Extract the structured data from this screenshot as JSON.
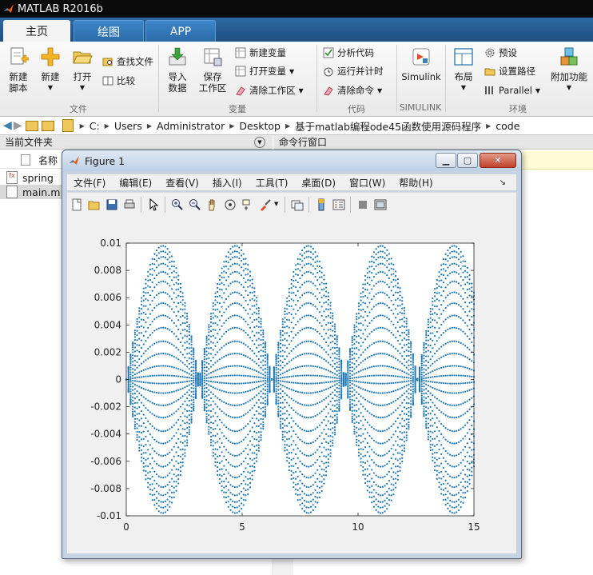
{
  "app": {
    "title": "MATLAB R2016b"
  },
  "tabs": [
    {
      "label": "主页",
      "active": true
    },
    {
      "label": "绘图",
      "active": false
    },
    {
      "label": "APP",
      "active": false
    }
  ],
  "ribbon": {
    "file_group": {
      "label": "文件",
      "new_script": [
        "新建",
        "脚本"
      ],
      "new": "新建",
      "open": "打开",
      "find_files": "查找文件",
      "compare": "比较"
    },
    "variable_group": {
      "label": "变量",
      "import_data": [
        "导入",
        "数据"
      ],
      "save_workspace": [
        "保存",
        "工作区"
      ],
      "new_variable": "新建变量",
      "open_variable": "打开变量",
      "clear_workspace": "清除工作区"
    },
    "code_group": {
      "label": "代码",
      "analyze_code": "分析代码",
      "run_and_time": "运行并计时",
      "clear_commands": "清除命令"
    },
    "simulink_group": {
      "label": "SIMULINK",
      "simulink": "Simulink"
    },
    "environment_group": {
      "label": "环境",
      "layout": "布局",
      "preferences": "预设",
      "set_path": "设置路径",
      "parallel": "Parallel",
      "addons": "附加功能"
    }
  },
  "address": {
    "crumbs": [
      "C:",
      "Users",
      "Administrator",
      "Desktop",
      "基于matlab编程ode45函数使用源码程序",
      "code"
    ]
  },
  "left_pane": {
    "header": "当前文件夹",
    "column_name": "名称",
    "files": [
      "spring",
      "main.m"
    ]
  },
  "right_pane": {
    "header": "命令行窗口"
  },
  "figure": {
    "title": "Figure 1",
    "menu": [
      "文件(F)",
      "编辑(E)",
      "查看(V)",
      "插入(I)",
      "工具(T)",
      "桌面(D)",
      "窗口(W)",
      "帮助(H)"
    ],
    "colors": {
      "series": "#1f77b4",
      "axes_bg": "#ffffff",
      "window_bg": "#f0f0f0"
    }
  },
  "chart_data": {
    "type": "scatter",
    "title": "",
    "xlabel": "",
    "ylabel": "",
    "xlim": [
      0,
      15
    ],
    "ylim": [
      -0.01,
      0.01
    ],
    "xticks": [
      0,
      5,
      10,
      15
    ],
    "yticks": [
      0.01,
      0.008,
      0.006,
      0.004,
      0.002,
      0,
      -0.002,
      -0.004,
      -0.006,
      -0.008,
      -0.01
    ],
    "ytick_labels": [
      "0.01",
      "0.008",
      "0.006",
      "0.004",
      "0.002",
      "0",
      "-0.002",
      "-0.004",
      "-0.006",
      "-0.008",
      "-0.01"
    ],
    "grid": false,
    "series_description": "family of curves y = A*sin(x) sampled as dots, amplitudes symmetric around 0",
    "amplitudes": [
      0.0098,
      0.0094,
      0.009,
      0.0085,
      0.0079,
      0.0072,
      0.0064,
      0.0056,
      0.0047,
      0.0038,
      0.0028,
      0.0019,
      0.001,
      0.0003,
      -0.0003,
      -0.001,
      -0.0019,
      -0.0028,
      -0.0038,
      -0.0047,
      -0.0056,
      -0.0064,
      -0.0072,
      -0.0079,
      -0.0085,
      -0.009,
      -0.0094,
      -0.0098
    ],
    "x_range": [
      0,
      15
    ],
    "points_per_series": 160
  }
}
